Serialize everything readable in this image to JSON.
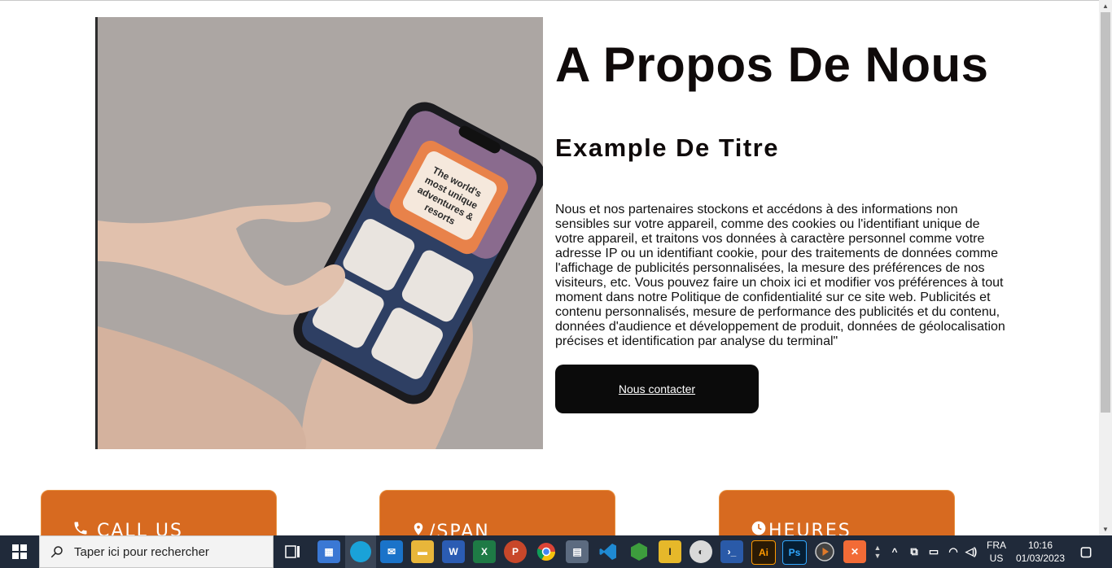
{
  "about": {
    "title": "A Propos De Nous",
    "subtitle": "Example De Titre",
    "paragraph": "Nous et nos partenaires stockons et accédons à des informations non sensibles sur votre appareil, comme des cookies ou l'identifiant unique de votre appareil, et traitons vos données à caractère personnel comme votre adresse IP ou un identifiant cookie, pour des traitements de données comme l'affichage de publicités personnalisées, la mesure des préférences de nos visiteurs, etc. Vous pouvez faire un choix ici et modifier vos préférences à tout moment dans notre Politique de confidentialité sur ce site web. Publicités et contenu personnalisés, mesure de performance des publicités et du contenu, données d'audience et développement de produit, données de géolocalisation précises et identification par analyse du terminal\"",
    "button_label": "Nous contacter",
    "image_text": "The world's most unique adventures & resorts"
  },
  "cards": [
    {
      "icon": "phone-icon",
      "label": "CALL US"
    },
    {
      "icon": "location-pin-icon",
      "label": "/SPAN"
    },
    {
      "icon": "clock-icon",
      "label": "HEURES"
    }
  ],
  "colors": {
    "card_bg": "#d76a20",
    "button_bg": "#0b0b0b",
    "taskbar_bg": "#202a3a"
  },
  "taskbar": {
    "search_placeholder": "Taper ici pour rechercher",
    "apps": [
      "task-view-icon",
      "microsoft-store-icon",
      "edge-icon",
      "mail-icon",
      "file-explorer-icon",
      "word-icon",
      "excel-icon",
      "powerpoint-icon",
      "chrome-icon",
      "network-app-icon",
      "vscode-icon",
      "node-icon",
      "app-icon",
      "paint-icon",
      "powershell-icon",
      "illustrator-icon",
      "photoshop-icon",
      "media-player-icon",
      "xampp-icon"
    ],
    "language_top": "FRA",
    "language_bottom": "US",
    "time": "10:16",
    "date": "01/03/2023"
  }
}
